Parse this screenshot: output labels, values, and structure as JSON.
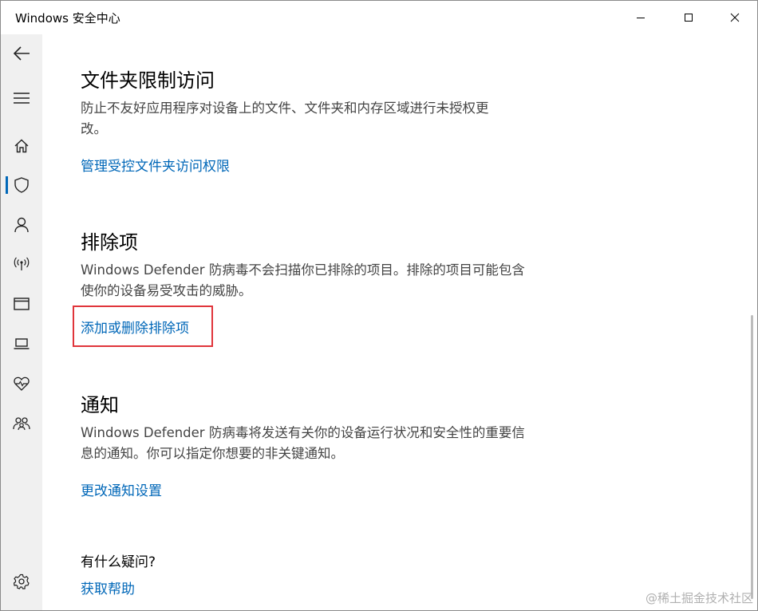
{
  "window": {
    "title": "Windows 安全中心"
  },
  "sections": [
    {
      "title": "文件夹限制访问",
      "desc_lines": [
        "防止不友好应用程序对设备上的文件、文件夹和内存区域进行未授权更",
        "改。"
      ],
      "link": "管理受控文件夹访问权限"
    },
    {
      "title": "排除项",
      "desc_lines": [
        "Windows Defender 防病毒不会扫描你已排除的项目。排除的项目可能包含",
        "使你的设备易受攻击的威胁。"
      ],
      "link": "添加或删除排除项"
    },
    {
      "title": "通知",
      "desc_lines": [
        "Windows Defender 防病毒将发送有关你的设备运行状况和安全性的重要信",
        "息的通知。你可以指定你想要的非关键通知。"
      ],
      "link": "更改通知设置"
    }
  ],
  "help": {
    "title": "有什么疑问?",
    "link": "获取帮助"
  },
  "watermark": "@稀土掘金技术社区",
  "colors": {
    "link": "#0067b8",
    "highlight": "#e0353b",
    "sidebar_bg": "#f0f0f0",
    "active_indicator": "#0067b8"
  },
  "icons": {
    "back": "back-arrow-icon",
    "menu": "hamburger-menu-icon",
    "home": "home-icon",
    "virus": "shield-icon",
    "account": "person-icon",
    "firewall": "wireless-antenna-icon",
    "app_browser": "browser-window-icon",
    "device_security": "laptop-icon",
    "device_health": "heart-pulse-icon",
    "family": "family-icon",
    "settings": "gear-icon"
  }
}
